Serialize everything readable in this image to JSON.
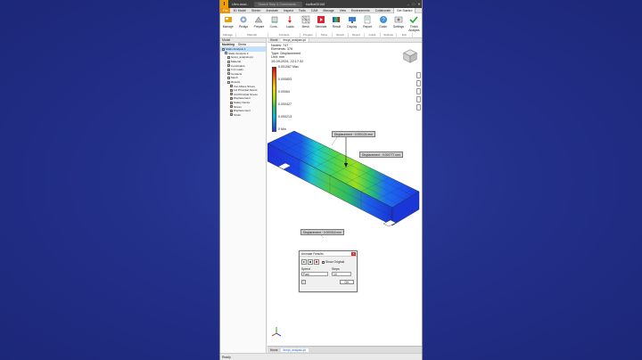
{
  "titlebar": {
    "logo": "I",
    "file_name": "Ulew.assd...",
    "search_placeholder": "Search Help & Commands...",
    "user": "kadibal35168",
    "win_controls": [
      "–",
      "□",
      "✕"
    ]
  },
  "tabs": [
    "File",
    "3D Model",
    "Sketch",
    "Annotate",
    "Inspect",
    "Tools",
    "CAM",
    "Manage",
    "View",
    "Environments",
    "Collaborate",
    "Get Started",
    "FEA"
  ],
  "active_tab": "Get Started",
  "ribbon": {
    "buttons": [
      {
        "label": "Manage",
        "icon": "manage-icon"
      },
      {
        "label": "Pedigo",
        "icon": "pedigo-icon"
      },
      {
        "label": "Prepare",
        "icon": "prepare-icon"
      },
      {
        "label": "Cons...",
        "icon": "constraints-icon"
      },
      {
        "label": "Loads",
        "icon": "loads-icon"
      },
      {
        "label": "Mesh",
        "icon": "mesh-icon"
      },
      {
        "label": "Simulate",
        "icon": "simulate-icon"
      },
      {
        "label": "Result",
        "icon": "result-icon"
      },
      {
        "label": "Display",
        "icon": "display-icon"
      },
      {
        "label": "Report",
        "icon": "report-icon"
      },
      {
        "label": "Guide",
        "icon": "guide-icon"
      },
      {
        "label": "Settings",
        "icon": "settings-icon"
      },
      {
        "label": "Finish Analysis",
        "icon": "finish-icon"
      }
    ],
    "groups": [
      "Manage",
      "Material",
      "Contacts",
      "Prepare",
      "Solve",
      "Result",
      "Report",
      "Guide",
      "Settings",
      "Exit"
    ]
  },
  "browser": {
    "header": "Model",
    "tabs": [
      "Modeling",
      "Stress"
    ],
    "items": [
      {
        "label": "Static Analysis 1",
        "indent": 0,
        "selected": true
      },
      {
        "label": "Static Analysis 2",
        "indent": 1,
        "selected": false
      },
      {
        "label": "fempt_analysis.ipt",
        "indent": 2,
        "selected": false
      },
      {
        "label": "Material",
        "indent": 2,
        "selected": false
      },
      {
        "label": "Constraints",
        "indent": 2,
        "selected": false
      },
      {
        "label": "3-4 Loads",
        "indent": 2,
        "selected": false
      },
      {
        "label": "Contacts",
        "indent": 2,
        "selected": false
      },
      {
        "label": "Mesh",
        "indent": 2,
        "selected": false
      },
      {
        "label": "Results",
        "indent": 2,
        "selected": false
      },
      {
        "label": "Von Mises Stress",
        "indent": 3,
        "selected": false
      },
      {
        "label": "1st Principal Stress",
        "indent": 3,
        "selected": false
      },
      {
        "label": "3rd Principal Stress",
        "indent": 3,
        "selected": false
      },
      {
        "label": "Displacement",
        "indent": 3,
        "selected": false
      },
      {
        "label": "Safety Factor",
        "indent": 3,
        "selected": false
      },
      {
        "label": "Stress",
        "indent": 3,
        "selected": false
      },
      {
        "label": "Displacement",
        "indent": 3,
        "selected": false
      },
      {
        "label": "Strain",
        "indent": 3,
        "selected": false
      }
    ]
  },
  "viewport": {
    "doc_tabs": [
      "Home",
      "fempt_analysis.ipt"
    ],
    "info": [
      "Nodes: 747",
      "Elements: 376",
      "Type: Displacement",
      "Unit: mm",
      "19-09-2024, 22:17:32"
    ],
    "legend": [
      {
        "label": "0.001067 Max"
      },
      {
        "label": "0.000853"
      },
      {
        "label": "0.00064"
      },
      {
        "label": "0.000427"
      },
      {
        "label": "0.000213"
      },
      {
        "label": "0 Min"
      }
    ],
    "callouts": [
      "Displacement : 0.000124 mm",
      "Displacement : 0.000777 mm",
      "Displacement : 0.000016 mm"
    ]
  },
  "dialog": {
    "title": "Animate Results",
    "show_original_label": "Show Original",
    "speed_label": "Speed",
    "steps_label": "Steps",
    "speed_value": "Fast",
    "steps_value": "10",
    "ok_label": "OK",
    "help_label": "?",
    "close_label": "✕"
  },
  "statusbar": {
    "text": "Ready"
  }
}
